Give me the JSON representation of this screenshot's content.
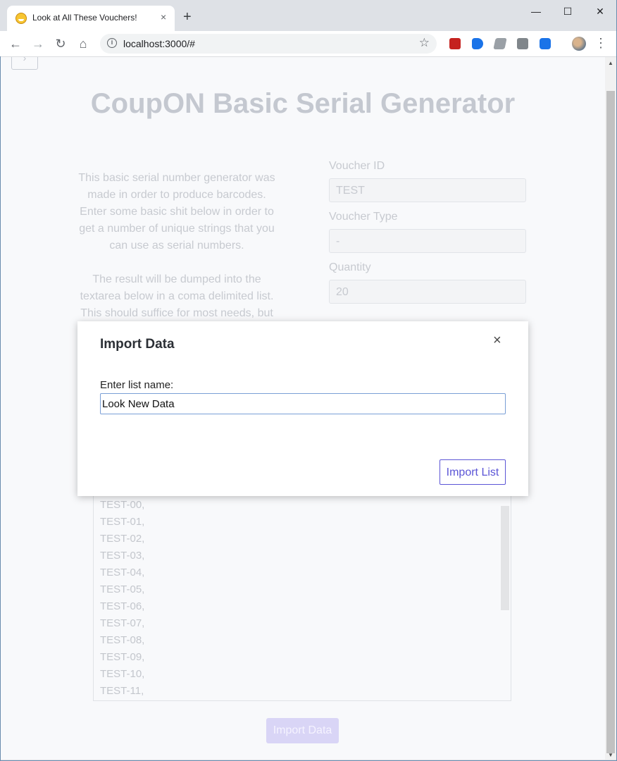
{
  "browser": {
    "tab_title": "Look at All These Vouchers!",
    "tab_close": "×",
    "new_tab": "+",
    "url": "localhost:3000/#",
    "window_controls": {
      "minimize": "—",
      "maximize": "☐",
      "close": "✕"
    },
    "nav": {
      "back": "←",
      "forward": "→",
      "reload": "↻",
      "home": "⌂"
    },
    "star": "☆",
    "menu": "⋮",
    "info": "i",
    "extension_colors": [
      "#d93025",
      "#1a73e8",
      "#5f6368",
      "#9aa0a6",
      "#1a73e8"
    ]
  },
  "page": {
    "title": "CoupON Basic Serial Generator",
    "top_box_glyph": "›",
    "intro_p1": "This basic serial number generator was made in order to produce barcodes. Enter some basic shit below in order to get a number of unique strings that you can use as serial numbers.",
    "intro_p2": "The result will be dumped into the textarea below in a coma delimited list. This should suffice for most needs, but",
    "fields": {
      "voucher_id_label": "Voucher ID",
      "voucher_id_value": "TEST",
      "voucher_type_label": "Voucher Type",
      "voucher_type_value": "-",
      "quantity_label": "Quantity",
      "quantity_value": "20"
    },
    "results": [
      "TEST-00,",
      "TEST-01,",
      "TEST-02,",
      "TEST-03,",
      "TEST-04,",
      "TEST-05,",
      "TEST-06,",
      "TEST-07,",
      "TEST-08,",
      "TEST-09,",
      "TEST-10,",
      "TEST-11,"
    ],
    "import_data_button": "Import Data"
  },
  "modal": {
    "title": "Import Data",
    "close": "×",
    "label": "Enter list name:",
    "input_value": "Look New Data",
    "submit_button": "Import List"
  }
}
